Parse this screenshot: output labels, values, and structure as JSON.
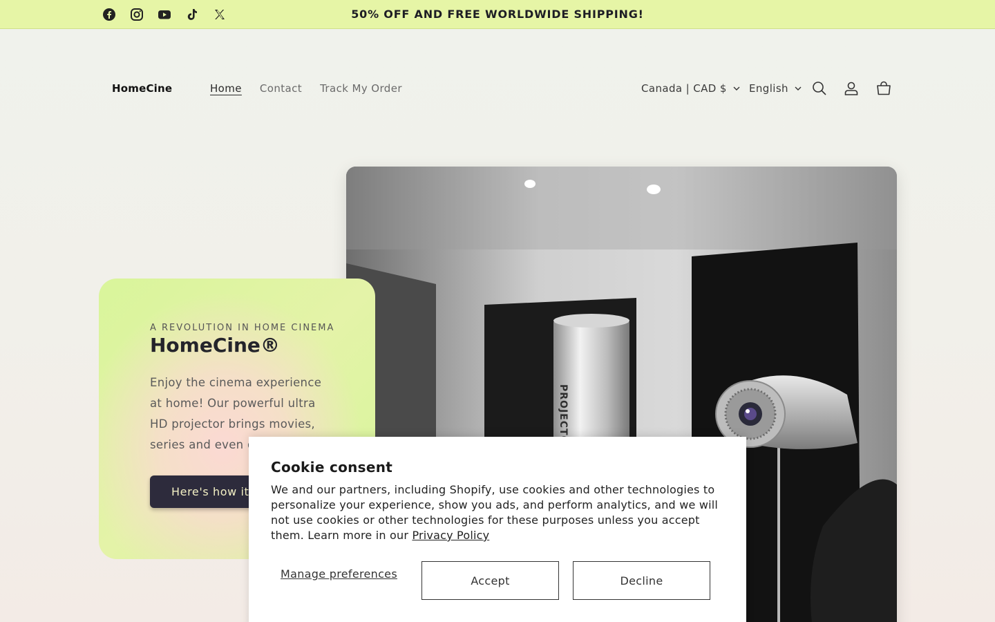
{
  "announcement": {
    "text": "50% OFF AND FREE WORLDWIDE SHIPPING!",
    "social_icons": [
      "facebook-icon",
      "instagram-icon",
      "youtube-icon",
      "tiktok-icon",
      "x-icon"
    ]
  },
  "header": {
    "logo": "HomeCine",
    "nav": [
      "Home",
      "Contact",
      "Track My Order"
    ],
    "active_nav": "Home",
    "country_selector": "Canada | CAD $",
    "language_selector": "English",
    "icons": [
      "search-icon",
      "account-icon",
      "cart-icon"
    ]
  },
  "hero": {
    "eyebrow": "A REVOLUTION IN HOME CINEMA",
    "title": "HomeCine®",
    "description": "Enjoy the cinema experience at home! Our powerful ultra HD projector brings movies, series and even games t",
    "button": "Here's how it",
    "image_text": "PROJECTOR"
  },
  "cookie": {
    "title": "Cookie consent",
    "body": "We and our partners, including Shopify, use cookies and other technologies to personalize your experience, show you ads, and perform analytics, and we will not use cookies or other technologies for these purposes unless you accept them. Learn more in our",
    "privacy_link": "Privacy Policy",
    "manage": "Manage preferences",
    "accept": "Accept",
    "decline": "Decline"
  },
  "colors": {
    "announcement_bg": "#e6f5a6",
    "button_bg": "#2d2b3c",
    "button_text": "#f4f1c5"
  }
}
